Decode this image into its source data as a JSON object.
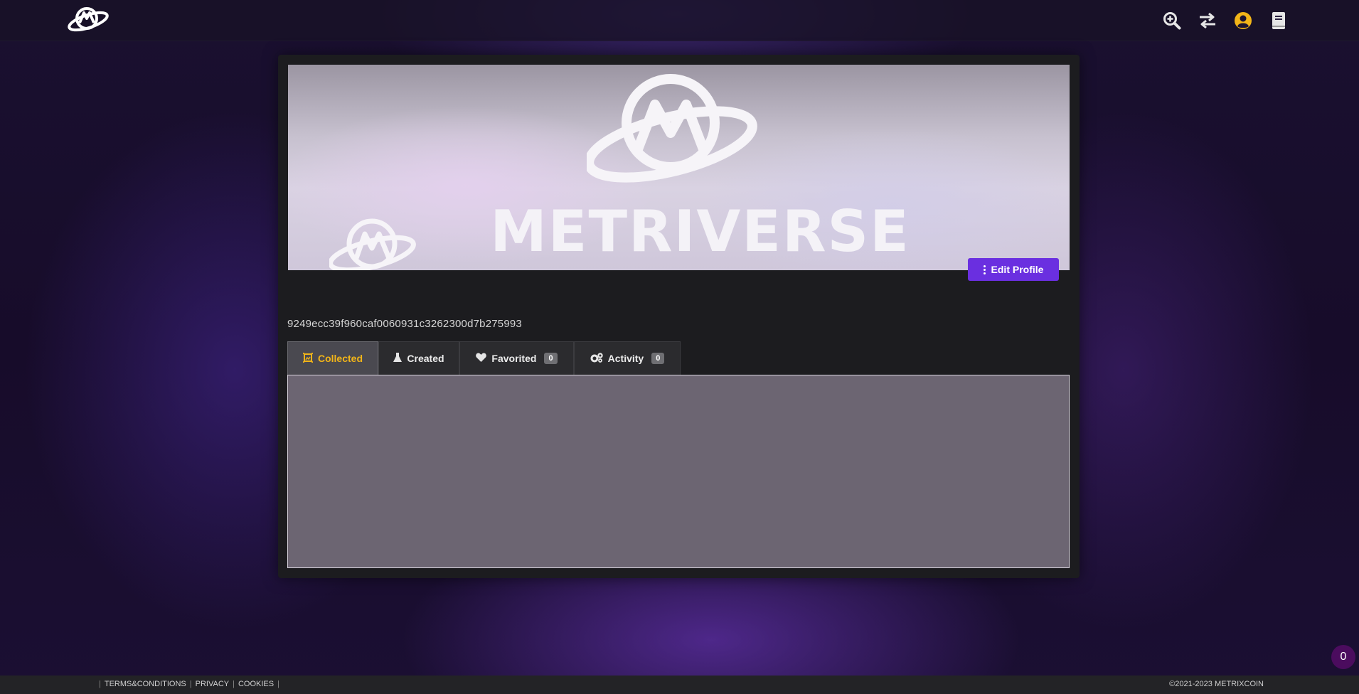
{
  "header": {
    "logo_icon": "metriverse-planet-logo",
    "icons": [
      "zoom-in-icon",
      "swap-arrows-icon",
      "user-circle-icon",
      "book-icon"
    ],
    "user_icon_color": "#f2b518"
  },
  "banner": {
    "wordmark": "METRIVERSE"
  },
  "profile": {
    "edit_label": "Edit Profile",
    "wallet_id": "9249ecc39f960caf0060931c3262300d7b275993"
  },
  "tabs": [
    {
      "label": "Collected",
      "icon": "frame-icon",
      "active": true
    },
    {
      "label": "Created",
      "icon": "flask-icon"
    },
    {
      "label": "Favorited",
      "icon": "heart-icon",
      "count": "0"
    },
    {
      "label": "Activity",
      "icon": "gears-icon",
      "count": "0"
    }
  ],
  "footer": {
    "links": [
      "TERMS&CONDITIONS",
      "PRIVACY",
      "COOKIES"
    ],
    "separator": "|",
    "copyright": "©2021-2023 METRIXCOIN"
  },
  "chat_badge": {
    "count": "0"
  },
  "colors": {
    "accent_purple": "#6a2fe0",
    "active_tab_text": "#f2b518"
  }
}
